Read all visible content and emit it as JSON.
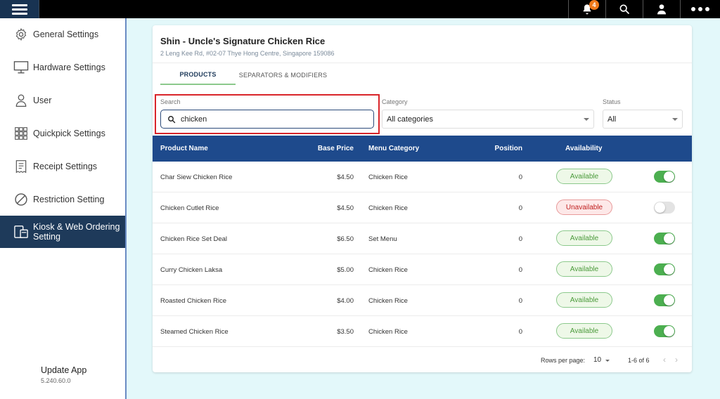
{
  "topbar": {
    "notification_count": "4",
    "icons": [
      "menu-icon",
      "bell-icon",
      "search-icon",
      "user-icon",
      "more-icon"
    ]
  },
  "sidebar": {
    "items": [
      {
        "label": "General Settings",
        "icon": "gear-icon"
      },
      {
        "label": "Hardware Settings",
        "icon": "monitor-icon"
      },
      {
        "label": "User",
        "icon": "user-icon"
      },
      {
        "label": "Quickpick Settings",
        "icon": "grid-icon"
      },
      {
        "label": "Receipt Settings",
        "icon": "receipt-icon"
      },
      {
        "label": "Restriction Setting",
        "icon": "block-icon"
      },
      {
        "label": "Kiosk & Web Ordering Setting",
        "icon": "kiosk-icon",
        "active": true
      }
    ],
    "update_title": "Update App",
    "update_version": "5.240.60.0"
  },
  "store": {
    "name": "Shin - Uncle's Signature Chicken Rice",
    "address": "2 Leng Kee Rd, #02-07 Thye Hong Centre, Singapore 159086"
  },
  "tabs": [
    {
      "label": "PRODUCTS",
      "active": true
    },
    {
      "label": "SEPARATORS & MODIFIERS",
      "active": false
    }
  ],
  "filters": {
    "search_label": "Search",
    "search_value": "chicken",
    "category_label": "Category",
    "category_value": "All categories",
    "status_label": "Status",
    "status_value": "All"
  },
  "table": {
    "headers": {
      "name": "Product Name",
      "price": "Base Price",
      "category": "Menu Category",
      "position": "Position",
      "availability": "Availability"
    },
    "rows": [
      {
        "name": "Char Siew Chicken Rice",
        "price": "$4.50",
        "category": "Chicken Rice",
        "position": "0",
        "availability": "Available",
        "enabled": true
      },
      {
        "name": "Chicken Cutlet Rice",
        "price": "$4.50",
        "category": "Chicken Rice",
        "position": "0",
        "availability": "Unavailable",
        "enabled": false
      },
      {
        "name": "Chicken Rice Set Deal",
        "price": "$6.50",
        "category": "Set Menu",
        "position": "0",
        "availability": "Available",
        "enabled": true
      },
      {
        "name": "Curry Chicken Laksa",
        "price": "$5.00",
        "category": "Chicken Rice",
        "position": "0",
        "availability": "Available",
        "enabled": true
      },
      {
        "name": "Roasted Chicken Rice",
        "price": "$4.00",
        "category": "Chicken Rice",
        "position": "0",
        "availability": "Available",
        "enabled": true
      },
      {
        "name": "Steamed Chicken Rice",
        "price": "$3.50",
        "category": "Chicken Rice",
        "position": "0",
        "availability": "Available",
        "enabled": true
      }
    ]
  },
  "pagination": {
    "rows_per_page_label": "Rows per page:",
    "rows_per_page": "10",
    "range": "1-6 of 6"
  },
  "colors": {
    "header_bg": "#1e4a8c",
    "active_sidebar": "#1e3a5a",
    "highlight": "#d9252a",
    "toggle_on": "#4caf50"
  }
}
